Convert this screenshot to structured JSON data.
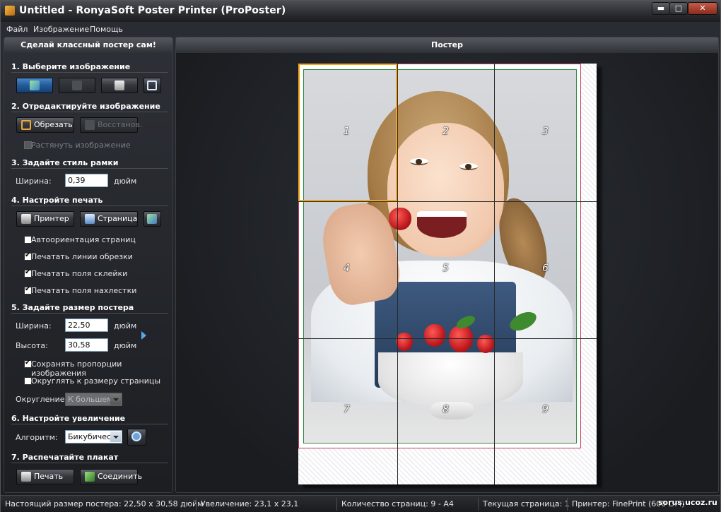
{
  "window": {
    "title": "Untitled - RonyaSoft Poster Printer (ProPoster)",
    "controls": {
      "minimize": "▬",
      "maximize": "□",
      "close": "✕"
    }
  },
  "menu": [
    "Файл",
    "Изображение",
    "Помощь"
  ],
  "left_panel": {
    "header": "Сделай классный постер сам!",
    "section1": {
      "title": "1. Выберите изображение"
    },
    "section2": {
      "title": "2. Отредактируйте изображение",
      "crop_button": "Обрезать",
      "restore_button": "Восстанов.",
      "stretch_label": "Растянуть изображение",
      "stretch_checked": false
    },
    "section3": {
      "title": "3. Задайте стиль рамки",
      "width_label": "Ширина:",
      "width_value": "0,39",
      "width_unit": "дюйм"
    },
    "section4": {
      "title": "4. Настройте печать",
      "printer_button": "Принтер",
      "page_button": "Страница",
      "checkboxes": [
        {
          "label": "Автоориентация страниц",
          "checked": false
        },
        {
          "label": "Печатать линии обрезки",
          "checked": true
        },
        {
          "label": "Печатать поля склейки",
          "checked": true
        },
        {
          "label": "Печатать поля нахлестки",
          "checked": true
        }
      ]
    },
    "section5": {
      "title": "5. Задайте размер постера",
      "width_label": "Ширина:",
      "width_value": "22,50",
      "width_unit": "дюйм",
      "height_label": "Высота:",
      "height_value": "30,58",
      "height_unit": "дюйм",
      "keep_ratio_label": "Сохранять пропорции изображения",
      "keep_ratio_checked": true,
      "round_label": "Округлять к размеру страницы",
      "round_checked": false,
      "rounding_label": "Округление:",
      "rounding_value": "К большему"
    },
    "section6": {
      "title": "6. Настройте увеличение",
      "algorithm_label": "Алгоритм:",
      "algorithm_value": "Бикубическ"
    },
    "section7": {
      "title": "7. Распечатайте плакат",
      "print_button": "Печать",
      "join_button": "Соединить"
    }
  },
  "right_panel": {
    "header": "Постер",
    "tiles": [
      "1",
      "2",
      "3",
      "4",
      "5",
      "6",
      "7",
      "8",
      "9"
    ],
    "selected_tile": "1"
  },
  "status": {
    "poster_size": "Настоящий размер постера: 22,50 x 30,58 дюйм",
    "zoom": "Увеличение: 23,1 x 23,1",
    "page_count": "Количество страниц: 9 - A4",
    "current_page": "Текущая страница: 1",
    "printer": "Принтер: FinePrint (600 DPI)"
  },
  "watermark": "sorus.ucoz.ru",
  "colors": {
    "accent_blue": "#235a9a",
    "selection": "#f2a51c",
    "crop_line": "#c0415a",
    "glue_line": "#2a8a3a"
  }
}
